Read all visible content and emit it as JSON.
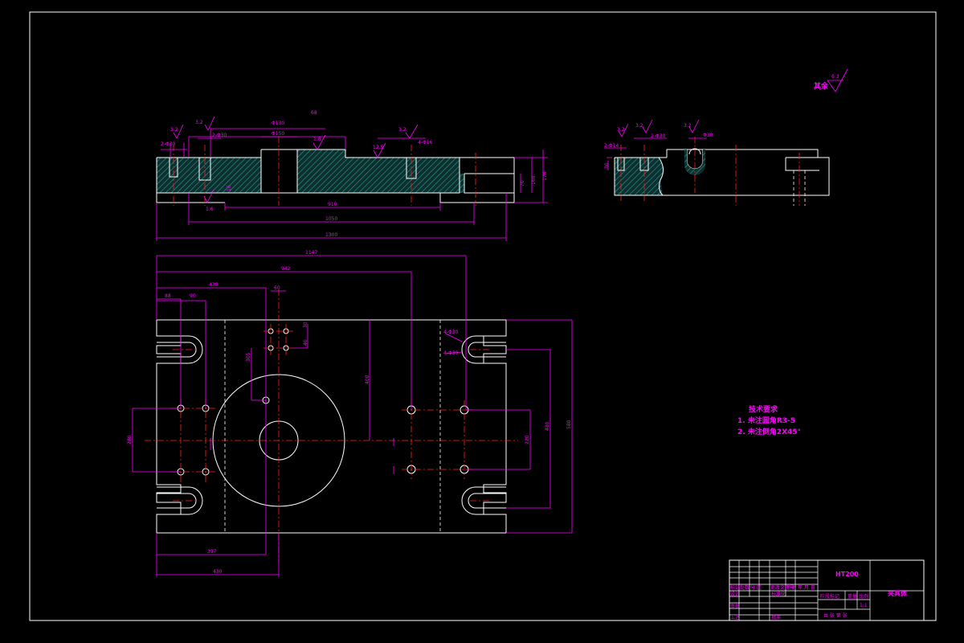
{
  "colors": {
    "background": "#000000",
    "outline": "#ffffff",
    "dimension": "#ff00ff",
    "centerline": "#ff2020",
    "hatch": "#1f8a86"
  },
  "front_view": {
    "dimensions": {
      "overall_top": "68",
      "bore_diameter": "Φ130",
      "inner_diameter": "Φ150",
      "counterbore_left": "2-Φ30",
      "counterbore_right": "4-Φ16",
      "hole_left": "2-Φ30",
      "roughness_a": "3.2",
      "roughness_b": "3.2",
      "roughness_c": "1.6",
      "roughness_d": "3.2",
      "roughness_e": "12.5",
      "roughness_f": "1.6",
      "length_inner": "910",
      "length_mid": "1050",
      "length_total": "1300",
      "height_a": "70",
      "height_b": "160",
      "height_c": "170",
      "depth_small": "16"
    }
  },
  "side_view": {
    "dimensions": {
      "hole_a": "2-Φ14",
      "hole_b": "2-Φ30",
      "hole_c": "Φ30",
      "roughness_a": "3.2",
      "roughness_b": "3.2",
      "roughness_c": "3.2",
      "depth": "30"
    }
  },
  "plan_view": {
    "dimensions": {
      "width_top": "1147",
      "width_mid": "942",
      "width_left": "430",
      "spacing_60": "60",
      "edge_88": "88",
      "edge_90": "90",
      "pin_a": "30",
      "pin_b": "40",
      "depth_400": "400",
      "dist_305": "305",
      "height_280": "280",
      "height_220": "220",
      "height_480": "480",
      "height_580": "580",
      "slot_a": "4-Φ30",
      "slot_b": "4-Φ30",
      "bottom_397": "397",
      "bottom_430": "430"
    }
  },
  "roughness_note": {
    "label": "其余",
    "value": "6.3"
  },
  "tech_requirements": {
    "title": "技术要求",
    "items": [
      "1. 未注圆角R3-5",
      "2. 未注倒角2X45°"
    ]
  },
  "title_block": {
    "material": "HT200",
    "part_name": "夹具体",
    "cells": {
      "mark": "标记",
      "count": "处数",
      "zone": "分 区",
      "change_doc": "更改文件号",
      "sign": "签名",
      "date": "年.月.日",
      "design": "设计",
      "standardize": "标准化",
      "stage_mark": "阶段标记",
      "weight": "重量",
      "scale": "比例",
      "scale_value": "1:1",
      "review": "审核",
      "process": "工艺",
      "approve": "批准",
      "sheets": "共 张 第 张"
    }
  }
}
